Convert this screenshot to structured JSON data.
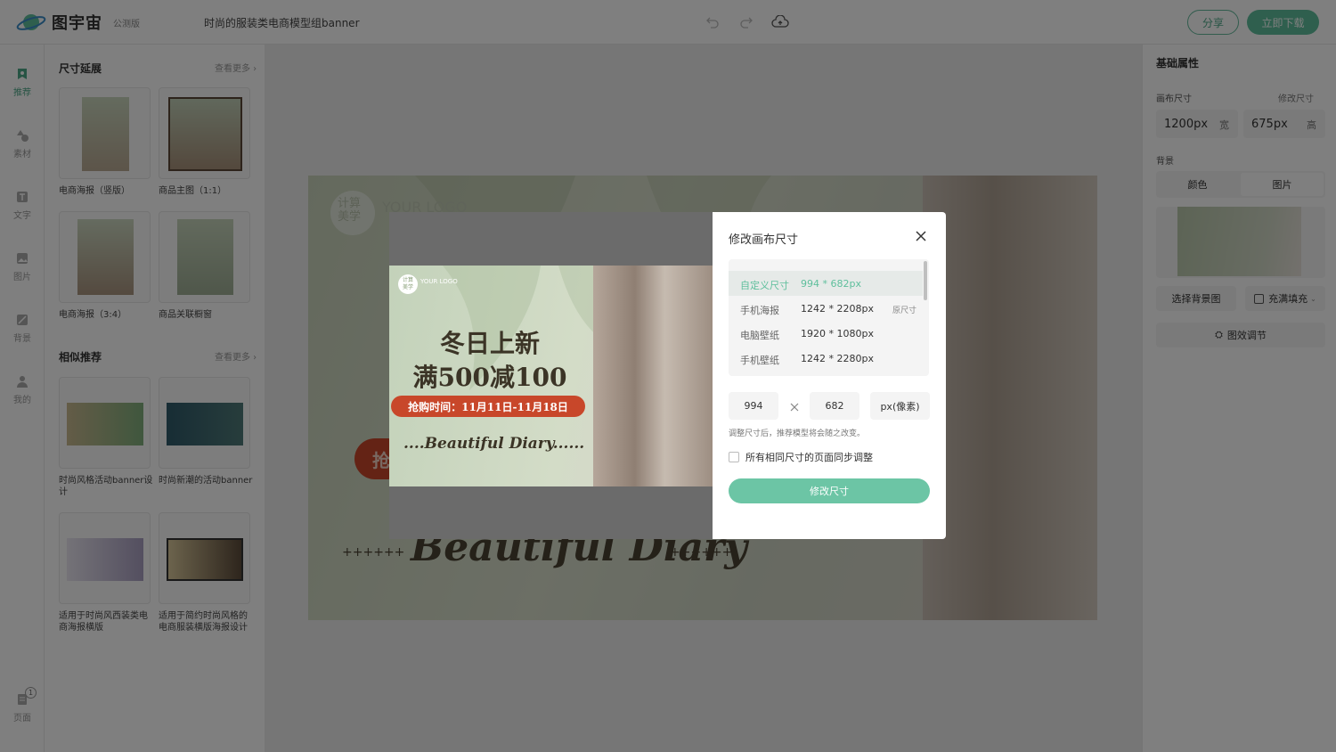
{
  "app": {
    "name": "图宇宙",
    "edition": "公测版",
    "doc_title": "时尚的服装类电商模型组banner"
  },
  "topbar": {
    "share_label": "分享",
    "download_label": "立即下载"
  },
  "rail": [
    {
      "label": "推荐",
      "icon": "recommend-icon"
    },
    {
      "label": "素材",
      "icon": "shapes-icon"
    },
    {
      "label": "文字",
      "icon": "text-icon"
    },
    {
      "label": "图片",
      "icon": "image-icon"
    },
    {
      "label": "背景",
      "icon": "background-icon"
    },
    {
      "label": "我的",
      "icon": "user-icon"
    },
    {
      "label": "页面",
      "icon": "pages-icon",
      "badge": "1"
    }
  ],
  "left_panel": {
    "size_ext_title": "尺寸延展",
    "similar_title": "相似推荐",
    "see_more": "查看更多",
    "size_ext": [
      {
        "caption": "电商海报（竖版）"
      },
      {
        "caption": "商品主图（1:1）"
      },
      {
        "caption": "电商海报（3:4）"
      },
      {
        "caption": "商品关联橱窗"
      }
    ],
    "similar": [
      {
        "caption": "时尚风格活动banner设计"
      },
      {
        "caption": "时尚新潮的活动banner"
      },
      {
        "caption": "适用于时尚风西装类电商海报横版"
      },
      {
        "caption": "适用于简约时尚风格的电商服装横版海报设计"
      }
    ]
  },
  "canvas": {
    "logo_line1": "计算",
    "logo_line2": "美学",
    "logo_text": "YOUR LOGO",
    "partial_badge": "抢",
    "script_text": "Beautiful Diary",
    "plus_left": "++++++",
    "plus_right": "++++++"
  },
  "preview_banner": {
    "logo_line1": "计算",
    "logo_line2": "美学",
    "logo_text": "YOUR LOGO",
    "headline1": "冬日上新",
    "headline2": "满500减100",
    "sale_time": "抢购时间：11月11日-11月18日",
    "script": "....Beautiful Diary......"
  },
  "right_panel": {
    "title": "基础属性",
    "canvas_size_label": "画布尺寸",
    "edit_size_label": "修改尺寸",
    "width_value": "1200px",
    "width_unit": "宽",
    "height_value": "675px",
    "height_unit": "高",
    "bg_label": "背景",
    "tab_color": "颜色",
    "tab_image": "图片",
    "select_bg": "选择背景图",
    "fill_mode": "充满填充",
    "effect_adjust": "图效调节"
  },
  "dialog": {
    "title": "修改画布尺寸",
    "sizes": [
      {
        "name": "自定义尺寸",
        "dims": "994 * 682px",
        "selected": true
      },
      {
        "name": "手机海报",
        "dims": "1242 * 2208px",
        "tag": "原尺寸"
      },
      {
        "name": "电脑壁纸",
        "dims": "1920 * 1080px"
      },
      {
        "name": "手机壁纸",
        "dims": "1242 * 2280px"
      }
    ],
    "width_input": "994",
    "height_input": "682",
    "unit": "px(像素)",
    "hint": "调整尺寸后，推荐模型将会随之改变。",
    "sync_label": "所有相同尺寸的页面同步调整",
    "apply_label": "修改尺寸"
  },
  "colors": {
    "accent": "#5ebf9c",
    "sale_red": "#c8472a",
    "headline": "#3b3426"
  }
}
